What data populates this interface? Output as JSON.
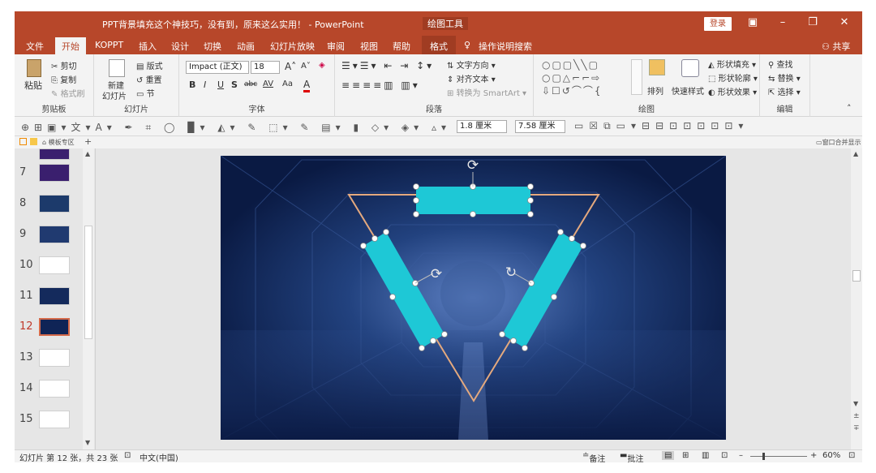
{
  "window": {
    "title": "PPT背景填充这个神技巧，没有到，原来这么实用！ - PowerPoint",
    "context_tab": "绘图工具",
    "login": "登录",
    "share": "共享"
  },
  "tabs": [
    "文件",
    "开始",
    "KOPPT",
    "插入",
    "设计",
    "切换",
    "动画",
    "幻灯片放映",
    "审阅",
    "视图",
    "帮助",
    "格式",
    "操作说明搜索"
  ],
  "ribbon": {
    "clipboard": {
      "paste": "粘贴",
      "cut": "剪切",
      "copy": "复制",
      "format_painter": "格式刷",
      "label": "剪贴板"
    },
    "slides": {
      "new_slide": "新建",
      "new_slide2": "幻灯片",
      "layout": "版式",
      "reset": "重置",
      "section": "节",
      "label": "幻灯片"
    },
    "font": {
      "name": "Impact (正文)",
      "size": "18",
      "bold": "B",
      "italic": "I",
      "underline": "U",
      "shadow": "S",
      "strike": "abc",
      "spacing": "AV",
      "case": "Aa",
      "color": "A",
      "label": "字体"
    },
    "paragraph": {
      "text_direction": "文字方向",
      "align_text": "对齐文本",
      "smartart": "转换为 SmartArt",
      "label": "段落"
    },
    "drawing": {
      "arrange": "排列",
      "quick_styles": "快速样式",
      "shape_fill": "形状填充",
      "shape_outline": "形状轮廓",
      "shape_effects": "形状效果",
      "label": "绘图"
    },
    "editing": {
      "find": "查找",
      "replace": "替换",
      "select": "选择",
      "label": "编辑"
    }
  },
  "quick_access": {
    "width": "1.8 厘米",
    "height": "7.58 厘米"
  },
  "panel_tabs": {
    "template": "模板专区",
    "right": "窗口合并显示"
  },
  "thumbnails": [
    {
      "num": "7",
      "color": "#3a1f6e"
    },
    {
      "num": "8",
      "color": "#1c3a6b"
    },
    {
      "num": "9",
      "color": "#203a70"
    },
    {
      "num": "10",
      "color": "#ffffff"
    },
    {
      "num": "11",
      "color": "#142a5c"
    },
    {
      "num": "12",
      "color": "#0f2456"
    },
    {
      "num": "13",
      "color": "#ffffff"
    },
    {
      "num": "14",
      "color": "#ffffff"
    },
    {
      "num": "15",
      "color": "#ffffff"
    }
  ],
  "selected_slide": "12",
  "status": {
    "slide_info": "幻灯片 第 12 张，共 23 张",
    "language": "中文(中国)",
    "notes": "备注",
    "comments": "批注",
    "zoom": "60%"
  },
  "colors": {
    "accent": "#b7472a",
    "shape_fill": "#1ec8d6",
    "triangle_stroke": "#e4a97e",
    "slide_bg": "#0c1f4c"
  }
}
